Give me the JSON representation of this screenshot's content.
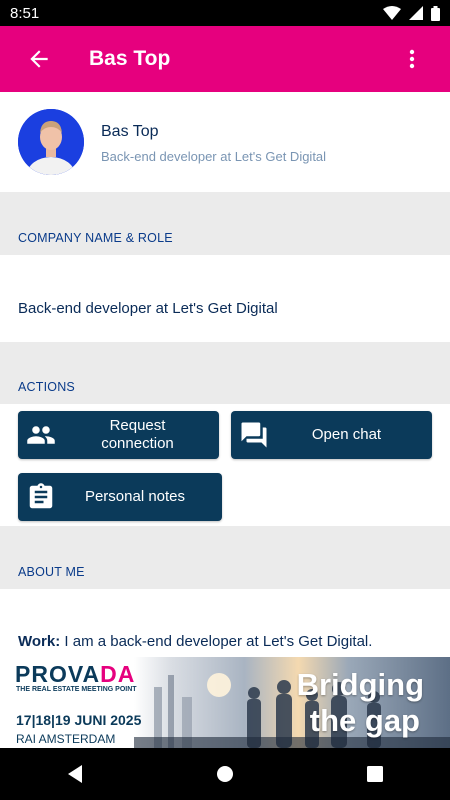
{
  "status_bar": {
    "time": "8:51",
    "icons": [
      "wifi-icon",
      "cellular-icon",
      "battery-icon"
    ]
  },
  "app_bar": {
    "title": "Bas Top",
    "back_icon": "arrow-back-icon",
    "menu_icon": "more-vert-icon",
    "color": "#e6007e"
  },
  "profile": {
    "name": "Bas Top",
    "subtitle": "Back-end developer at Let's Get Digital"
  },
  "company_section": {
    "label": "COMPANY NAME & ROLE",
    "value": "Back-end developer at Let's Get Digital"
  },
  "actions_section": {
    "label": "ACTIONS",
    "buttons": [
      {
        "label": "Request connection",
        "icon": "people-icon"
      },
      {
        "label": "Open chat",
        "icon": "chat-icon"
      },
      {
        "label": "Personal notes",
        "icon": "clipboard-icon"
      }
    ],
    "button_color": "#0b3a5a"
  },
  "about_section": {
    "label": "ABOUT ME",
    "work_label": "Work:",
    "work_text": " I am a back-end developer at Let's Get Digital."
  },
  "banner": {
    "brand_part1": "PROVA",
    "brand_part2": "DA",
    "tagline": "THE REAL ESTATE MEETING POINT",
    "dates": "17|18|19 JUNI 2025",
    "venue": "RAI AMSTERDAM",
    "slogan_line1": "Bridging",
    "slogan_line2": "the gap"
  },
  "nav_bar": {
    "icons": [
      "back-triangle-icon",
      "home-circle-icon",
      "recents-square-icon"
    ]
  }
}
